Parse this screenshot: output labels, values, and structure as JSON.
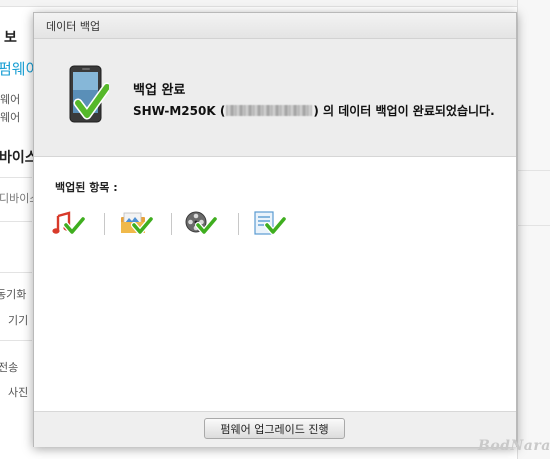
{
  "background": {
    "texts": [
      "보",
      "펌웨어",
      "웨어",
      "웨어",
      "바이스",
      "디바이스",
      "동기화",
      "기기",
      "전송",
      "사진"
    ]
  },
  "dialog": {
    "title": "데이터 백업",
    "status_title": "백업 완료",
    "device_model": "SHW-M250K",
    "message_open": "(",
    "message_close": ") 의 데이터 백업이 완료되었습니다.",
    "items_label": "백업된 항목 :",
    "items": [
      {
        "icon": "music-note-icon",
        "status": "check"
      },
      {
        "icon": "photo-folder-icon",
        "status": "check"
      },
      {
        "icon": "film-reel-icon",
        "status": "check"
      },
      {
        "icon": "document-icon",
        "status": "check"
      }
    ],
    "upgrade_button": "펌웨어 업그레이드 진행"
  },
  "watermark": "BodNara",
  "colors": {
    "check": "#3fae1f",
    "link": "#1a9fd4"
  }
}
